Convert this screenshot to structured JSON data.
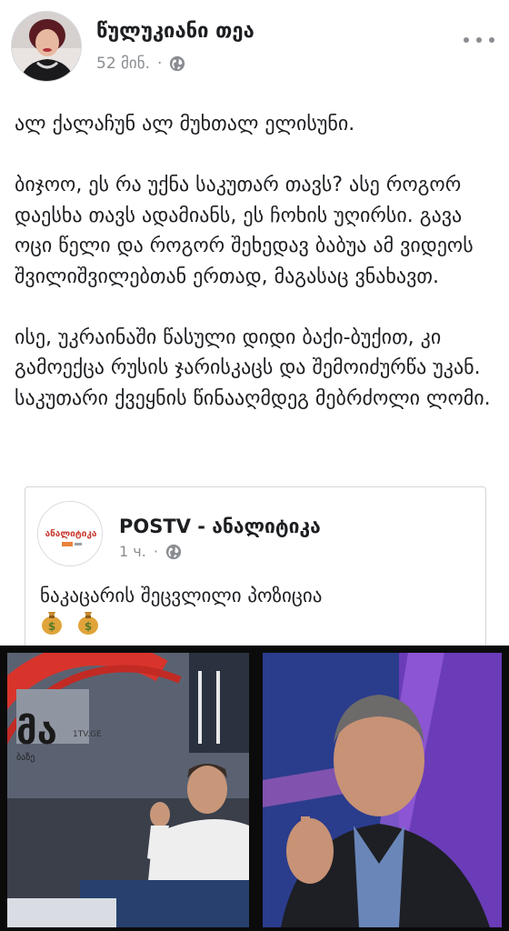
{
  "post": {
    "author": "წულუკიანი თეა",
    "time": "52 მინ.",
    "separator": "·",
    "privacy_icon": "globe-icon",
    "more_icon": "more-options-icon",
    "paragraphs": [
      "ალ ქალაჩუნ ალ მუხთალ ელისუნი.",
      "ბიჯოო, ეს რა უქნა საკუთარ თავს? ასე როგორ დაესხა თავს ადამიანს, ეს ჩოხის უღირსი. გავა ოცი წელი და როგორ შეხედავ ბაბუა ამ ვიდეოს შვილიშვილებთან ერთად, მაგასაც ვნახავთ.",
      "ისე, უკრაინაში წასული დიდი ბაქი-ბუქით, კი გამოექცა რუსის ჯარისკაცს და შემოიძურწა უკან. საკუთარი ქვეყნის წინააღმდეგ მებრძოლი ლომი."
    ]
  },
  "shared_post": {
    "author": "POSTV - ანალიტიკა",
    "time": "1 ч.",
    "separator": "·",
    "privacy_icon": "globe-icon",
    "logo_text": "ანალიტიკა",
    "text": "ნაკაცარის შეცვლილი პოზიცია",
    "emojis": [
      "money-bag-icon",
      "money-bag-icon"
    ]
  },
  "images": {
    "left_overlay_text": "მა",
    "left_overlay_small": "1TV.GE",
    "left_overlay_sub": "ბაზე"
  },
  "colors": {
    "text": "#1c1e21",
    "meta": "#8a8d91",
    "border": "#d3d6db",
    "logo_red": "#c8372d",
    "logo_orange": "#e8823a"
  }
}
